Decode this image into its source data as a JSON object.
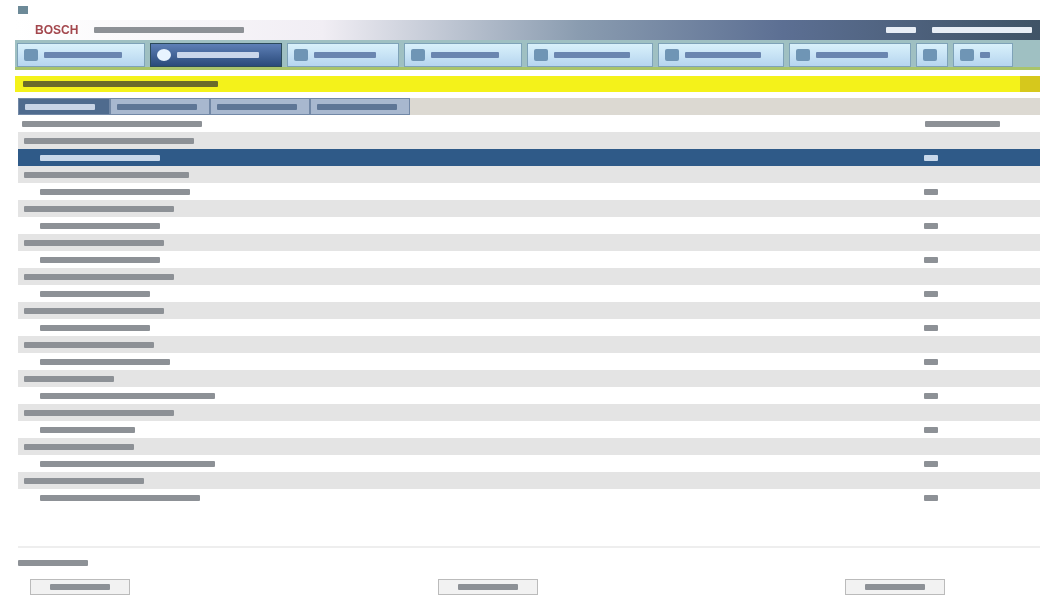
{
  "header": {
    "logo": "BOSCH"
  },
  "tabs": [
    {
      "selected": false
    },
    {
      "selected": true
    },
    {
      "selected": false
    },
    {
      "selected": false
    },
    {
      "selected": false
    },
    {
      "selected": false
    },
    {
      "selected": false
    },
    {
      "selected": false
    },
    {
      "selected": false
    }
  ],
  "subtabs": [
    {
      "selected": true
    },
    {
      "selected": false
    },
    {
      "selected": false
    },
    {
      "selected": false
    }
  ],
  "rows": [
    {
      "kind": "group",
      "selected": false
    },
    {
      "kind": "item",
      "selected": true
    },
    {
      "kind": "group",
      "selected": false
    },
    {
      "kind": "item",
      "selected": false
    },
    {
      "kind": "group",
      "selected": false
    },
    {
      "kind": "item",
      "selected": false
    },
    {
      "kind": "group",
      "selected": false
    },
    {
      "kind": "item",
      "selected": false
    },
    {
      "kind": "group",
      "selected": false
    },
    {
      "kind": "item",
      "selected": false
    },
    {
      "kind": "group",
      "selected": false
    },
    {
      "kind": "item",
      "selected": false
    },
    {
      "kind": "group",
      "selected": false
    },
    {
      "kind": "item",
      "selected": false
    },
    {
      "kind": "group",
      "selected": false
    },
    {
      "kind": "item",
      "selected": false
    },
    {
      "kind": "group",
      "selected": false
    },
    {
      "kind": "item",
      "selected": false
    },
    {
      "kind": "group",
      "selected": false
    },
    {
      "kind": "item",
      "selected": false
    },
    {
      "kind": "group",
      "selected": false
    },
    {
      "kind": "item",
      "selected": false
    }
  ],
  "buttons": [
    {
      "kind": "button"
    },
    {
      "kind": "button"
    },
    {
      "kind": "button"
    }
  ]
}
